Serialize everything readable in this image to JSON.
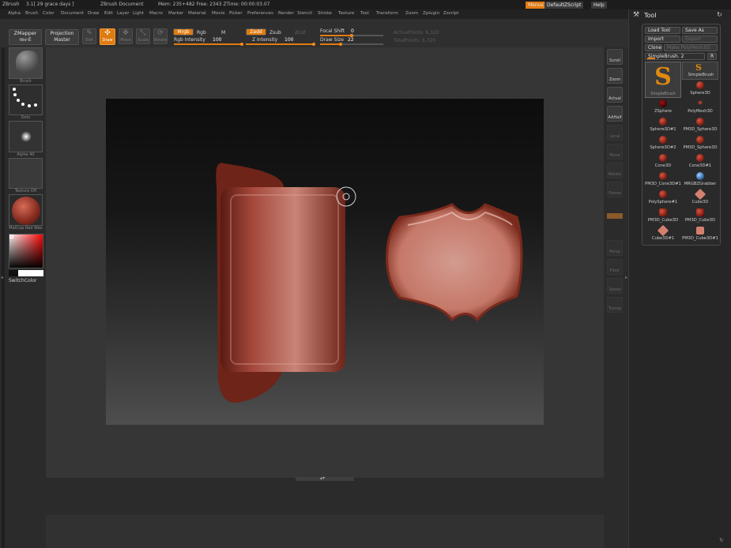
{
  "titlebar": {
    "app": "ZBrush",
    "version": "3.1[ 29 grace days ]",
    "document": "ZBrush Document",
    "stats": "Mem: 235+482 Free: 2343 ZTime: 00:00:03.07",
    "menus_label": "Menus",
    "script_label": "DefaultZScript",
    "help_label": "Help"
  },
  "menubar": {
    "items": [
      "Alpha",
      "Brush",
      "Color",
      "Document",
      "Draw",
      "Edit",
      "Layer",
      "Light",
      "Macro",
      "Marker",
      "Material",
      "Movie",
      "Picker",
      "Preferences",
      "Render",
      "Stencil",
      "Stroke",
      "Texture",
      "Tool",
      "Transform",
      "Zoom",
      "Zplugin",
      "Zscript"
    ]
  },
  "toolbar": {
    "zmapper": "ZMapper",
    "zmapper_sub": "rev-E",
    "projection": "Projection",
    "projection_sub": "Master",
    "edit": "Edit",
    "draw": "Draw",
    "move": "Move",
    "scale": "Scale",
    "rotate": "Rotate",
    "mrgb": "Mrgb",
    "rgb": "Rgb",
    "m": "M",
    "rgb_intensity_label": "Rgb Intensity",
    "rgb_intensity": "100",
    "zadd": "Zadd",
    "zsub": "Zsub",
    "zcut": "Zcut",
    "z_intensity_label": "Z Intensity",
    "z_intensity": "100",
    "focal_shift_label": "Focal Shift",
    "focal_shift": "0",
    "draw_size_label": "Draw Size",
    "draw_size": "22",
    "active_points": "ActivePoints: 6,320",
    "total_points": "TotalPoints: 6,320"
  },
  "leftshelf": {
    "brush_label": "Brush",
    "dots_label": "Dots",
    "alpha_label": "Alpha 40",
    "texture_label": "Texture Off",
    "material_label": "MatCap Red Wax",
    "switch_color": "SwitchColor"
  },
  "rightshelf": {
    "buttons": [
      "Scroll",
      "Zoom",
      "Actual",
      "AAHalf",
      "Local",
      "Move",
      "Rotate",
      "Frame",
      "Persp",
      "Floor",
      "Xpose",
      "Transp"
    ]
  },
  "tool_panel": {
    "title": "Tool",
    "load_tool": "Load Tool",
    "save_as": "Save As",
    "import": "Import",
    "export": "Export",
    "clone": "Clone",
    "make_polymesh": "Make PolyMesh3D",
    "current_tool": "SimpleBrush. 2",
    "r_label": "R",
    "big_label": "SimpleBrush",
    "items": [
      "SimpleBrush",
      "Sphere3D",
      "ZSphere",
      "PolyMesh3D",
      "Sphere3D#1",
      "PM3D_Sphere3D",
      "Sphere3D#2",
      "PM3D_Sphere3D",
      "Cone3D",
      "Cone3D#1",
      "PM3D_Cone3D#1",
      "MRGBZGrabber",
      "PolySphere#1",
      "Cube3D",
      "PM3D_Cube3D",
      "PM3D_Cube3D",
      "Cube3D#1",
      "PM3D_Cube3D#1"
    ]
  },
  "colors": {
    "accent": "#e07b10",
    "clay": "#8a2e22"
  }
}
